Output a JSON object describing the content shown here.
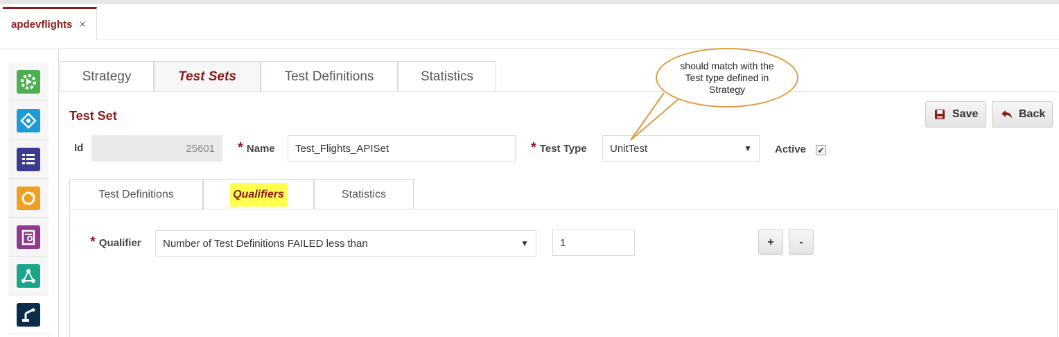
{
  "document_tab": {
    "label": "apdevflights",
    "close_glyph": "×"
  },
  "sidebar": {
    "items": [
      {
        "icon": "run-gear-icon",
        "color": "#4caf50"
      },
      {
        "icon": "network-icon",
        "color": "#1e9bd7"
      },
      {
        "icon": "list-icon",
        "color": "#3b3b8f"
      },
      {
        "icon": "refresh-icon",
        "color": "#f0a020"
      },
      {
        "icon": "report-icon",
        "color": "#8e3a8e"
      },
      {
        "icon": "flow-icon",
        "color": "#1aa58a"
      },
      {
        "icon": "robot-arm-icon",
        "color": "#0b2c4b"
      }
    ]
  },
  "main_tabs": [
    {
      "label": "Strategy"
    },
    {
      "label": "Test Sets"
    },
    {
      "label": "Test Definitions"
    },
    {
      "label": "Statistics"
    }
  ],
  "section_title": "Test Set",
  "toolbar": {
    "save_label": "Save",
    "back_label": "Back"
  },
  "form": {
    "id_label": "Id",
    "id_value": "25601",
    "name_label": "Name",
    "name_value": "Test_Flights_APISet",
    "test_type_label": "Test Type",
    "test_type_value": "UnitTest",
    "active_label": "Active",
    "required_mark": "*"
  },
  "sub_tabs": [
    {
      "label": "Test Definitions"
    },
    {
      "label": "Qualifiers"
    },
    {
      "label": "Statistics"
    }
  ],
  "qualifier": {
    "label": "Qualifier",
    "value": "Number of Test Definitions FAILED less than",
    "amount": "1",
    "add_label": "+",
    "remove_label": "-"
  },
  "callout": {
    "text": "should match with the Test type defined in Strategy"
  },
  "colors": {
    "accent": "#8b1a1a",
    "highlight": "#ffff4d",
    "callout_border": "#e09a3e"
  }
}
